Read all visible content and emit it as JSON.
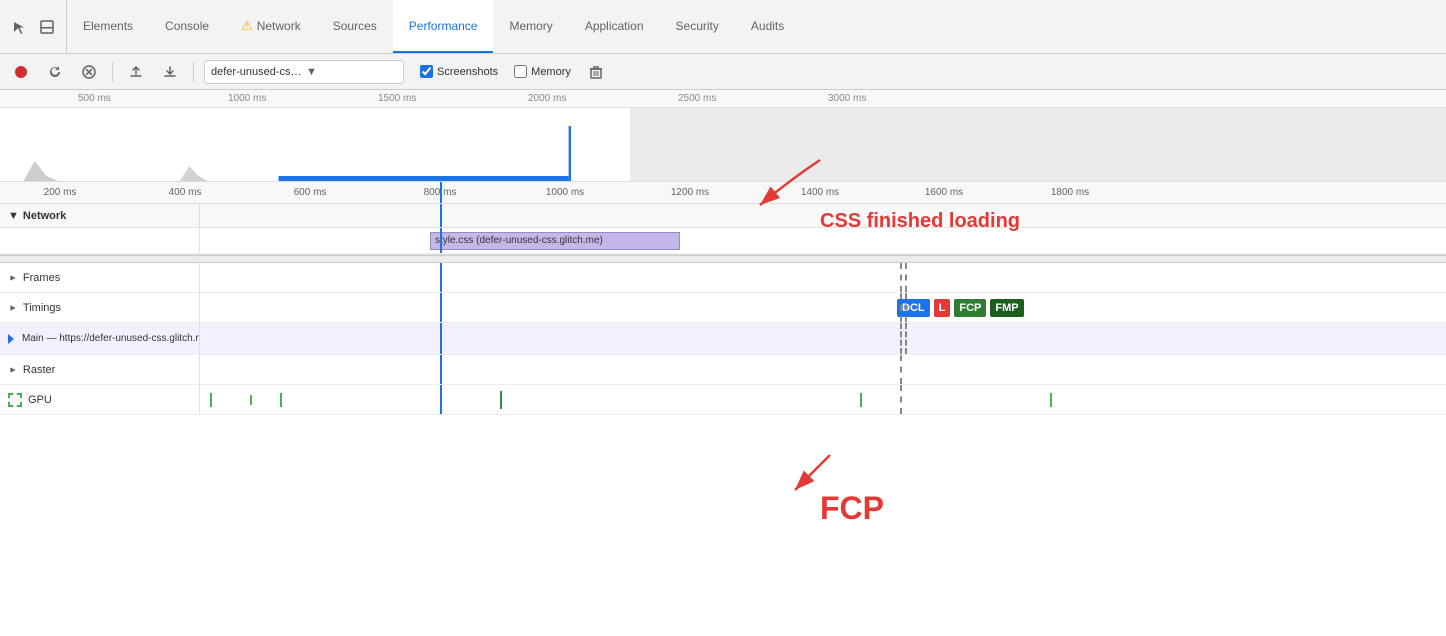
{
  "tabs": {
    "items": [
      {
        "id": "elements",
        "label": "Elements",
        "active": false,
        "warn": false
      },
      {
        "id": "console",
        "label": "Console",
        "active": false,
        "warn": false
      },
      {
        "id": "network",
        "label": "Network",
        "active": false,
        "warn": true
      },
      {
        "id": "sources",
        "label": "Sources",
        "active": false,
        "warn": false
      },
      {
        "id": "performance",
        "label": "Performance",
        "active": true,
        "warn": false
      },
      {
        "id": "memory",
        "label": "Memory",
        "active": false,
        "warn": false
      },
      {
        "id": "application",
        "label": "Application",
        "active": false,
        "warn": false
      },
      {
        "id": "security",
        "label": "Security",
        "active": false,
        "warn": false
      },
      {
        "id": "audits",
        "label": "Audits",
        "active": false,
        "warn": false
      }
    ]
  },
  "toolbar": {
    "url": "defer-unused-css.glitch....",
    "screenshots_label": "Screenshots",
    "memory_label": "Memory",
    "screenshots_checked": true,
    "memory_checked": false
  },
  "overview": {
    "ruler_ticks": [
      "500 ms",
      "1000 ms",
      "1500 ms",
      "2000 ms",
      "2500 ms",
      "3000 ms"
    ]
  },
  "timeline": {
    "ruler_ticks": [
      "200 ms",
      "400 ms",
      "600 ms",
      "800 ms",
      "1000 ms",
      "1200 ms",
      "1400 ms",
      "1600 ms",
      "1800 ms"
    ],
    "sections": [
      {
        "id": "network",
        "label": "Network",
        "expanded": true
      },
      {
        "id": "frames",
        "label": "Frames",
        "expanded": false
      },
      {
        "id": "timings",
        "label": "Timings",
        "expanded": false
      },
      {
        "id": "main",
        "label": "Main",
        "expanded": false
      },
      {
        "id": "raster",
        "label": "Raster",
        "expanded": false
      },
      {
        "id": "gpu",
        "label": "GPU",
        "expanded": false
      }
    ],
    "main_url": "https://defer-unused-css.glitch.me/index-unoptimized.html",
    "css_bar_label": "style.css (defer-unused-css.glitch.me)",
    "timings_badges": [
      {
        "id": "dcl",
        "label": "DCL",
        "class": "badge-dcl"
      },
      {
        "id": "l",
        "label": "L",
        "class": "badge-l"
      },
      {
        "id": "fcp",
        "label": "FCP",
        "class": "badge-fcp"
      },
      {
        "id": "fmp",
        "label": "FMP",
        "class": "badge-fmp"
      }
    ]
  },
  "annotations": {
    "css_finished": "CSS finished loading",
    "fcp": "FCP"
  },
  "colors": {
    "accent": "#1a73e8",
    "danger": "#e53935",
    "record": "#d32f2f"
  }
}
